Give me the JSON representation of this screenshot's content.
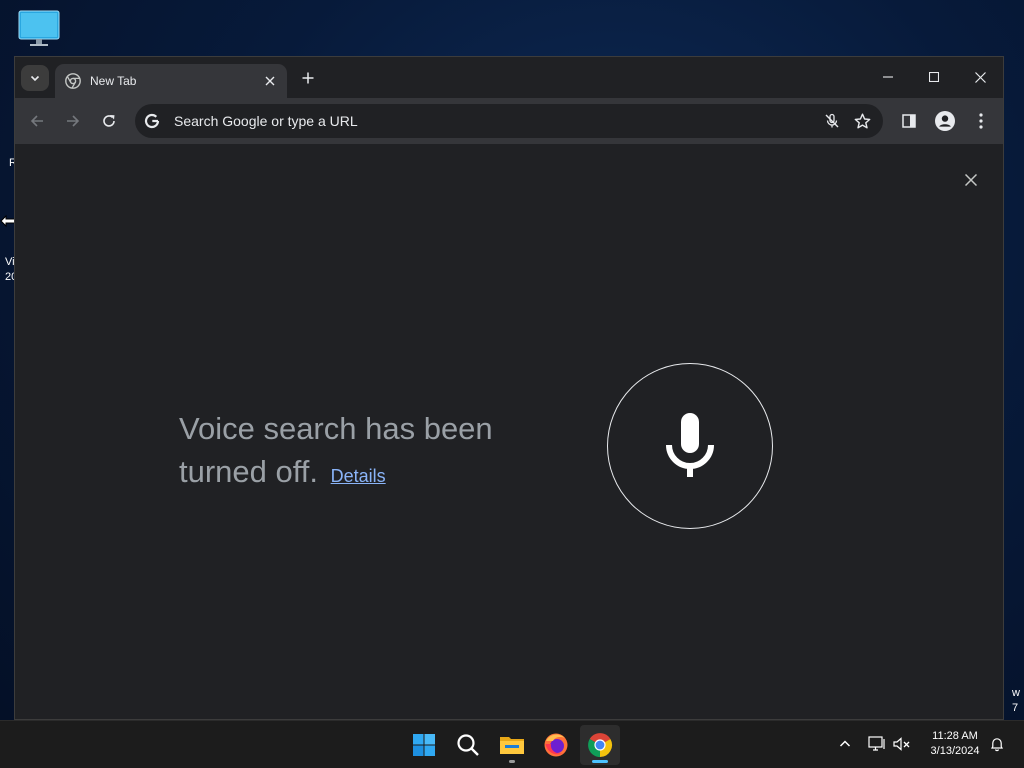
{
  "desktop": {
    "icon": "monitor-icon",
    "fragments": [
      "R",
      "Vi",
      "20",
      "w",
      "7"
    ]
  },
  "browser": {
    "tab": {
      "title": "New Tab",
      "favicon": "chrome-icon"
    },
    "omnibox": {
      "placeholder": "Search Google or type a URL"
    },
    "voice_search": {
      "message": "Voice search has been turned off.",
      "details_link": "Details"
    }
  },
  "taskbar": {
    "apps": [
      "start-icon",
      "search-icon",
      "file-explorer-icon",
      "firefox-icon",
      "chrome-icon"
    ],
    "active_app": "chrome-icon",
    "clock": {
      "time": "11:28 AM",
      "date": "3/13/2024"
    }
  },
  "colors": {
    "window_bg": "#202124",
    "toolbar_bg": "#35363a",
    "link": "#8ab4f8",
    "muted_text": "#9aa0a6",
    "taskbar_bg": "#1c1c1c",
    "accent": "#4cc2ff"
  }
}
